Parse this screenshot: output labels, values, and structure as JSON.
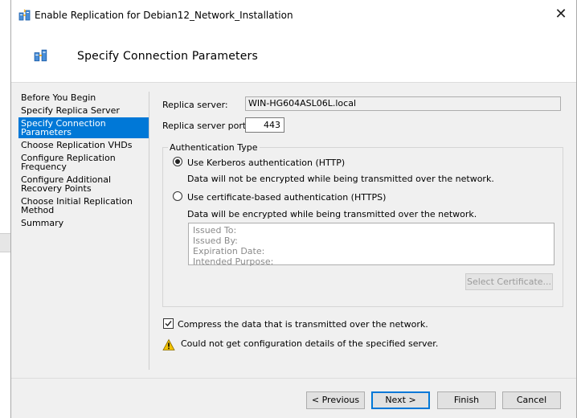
{
  "window": {
    "title": "Enable Replication for Debian12_Network_Installation",
    "close_glyph": "✕"
  },
  "header": {
    "title": "Specify Connection Parameters"
  },
  "nav": {
    "items": [
      {
        "label": "Before You Begin",
        "selected": false
      },
      {
        "label": "Specify Replica Server",
        "selected": false
      },
      {
        "label": "Specify Connection\nParameters",
        "selected": true
      },
      {
        "label": "Choose Replication VHDs",
        "selected": false
      },
      {
        "label": "Configure Replication\nFrequency",
        "selected": false
      },
      {
        "label": "Configure Additional\nRecovery Points",
        "selected": false
      },
      {
        "label": "Choose Initial Replication\nMethod",
        "selected": false
      },
      {
        "label": "Summary",
        "selected": false
      }
    ]
  },
  "form": {
    "replica_server_label": "Replica server:",
    "replica_server_value": "WIN-HG604ASL06L.local",
    "port_label": "Replica server port:",
    "port_value": "443",
    "auth_group_label": "Authentication Type",
    "kerberos_label": "Use Kerberos authentication (HTTP)",
    "kerberos_selected": true,
    "kerberos_desc": "Data will not be encrypted while being transmitted over the network.",
    "cert_label": "Use certificate-based authentication (HTTPS)",
    "cert_selected": false,
    "cert_desc": "Data will be encrypted while being transmitted over the network.",
    "cert_fields": {
      "issued_to": "Issued To:",
      "issued_by": "Issued By:",
      "expiration": "Expiration Date:",
      "purpose": "Intended Purpose:"
    },
    "select_cert_label": "Select Certificate...",
    "compress_label": "Compress the data that is transmitted over the network.",
    "compress_checked": true,
    "warning_text": "Could not get configuration details of the specified server."
  },
  "footer": {
    "previous_label": "< Previous",
    "next_label": "Next >",
    "finish_label": "Finish",
    "cancel_label": "Cancel"
  },
  "colors": {
    "selection": "#0078d7",
    "warning": "#f2c200"
  }
}
